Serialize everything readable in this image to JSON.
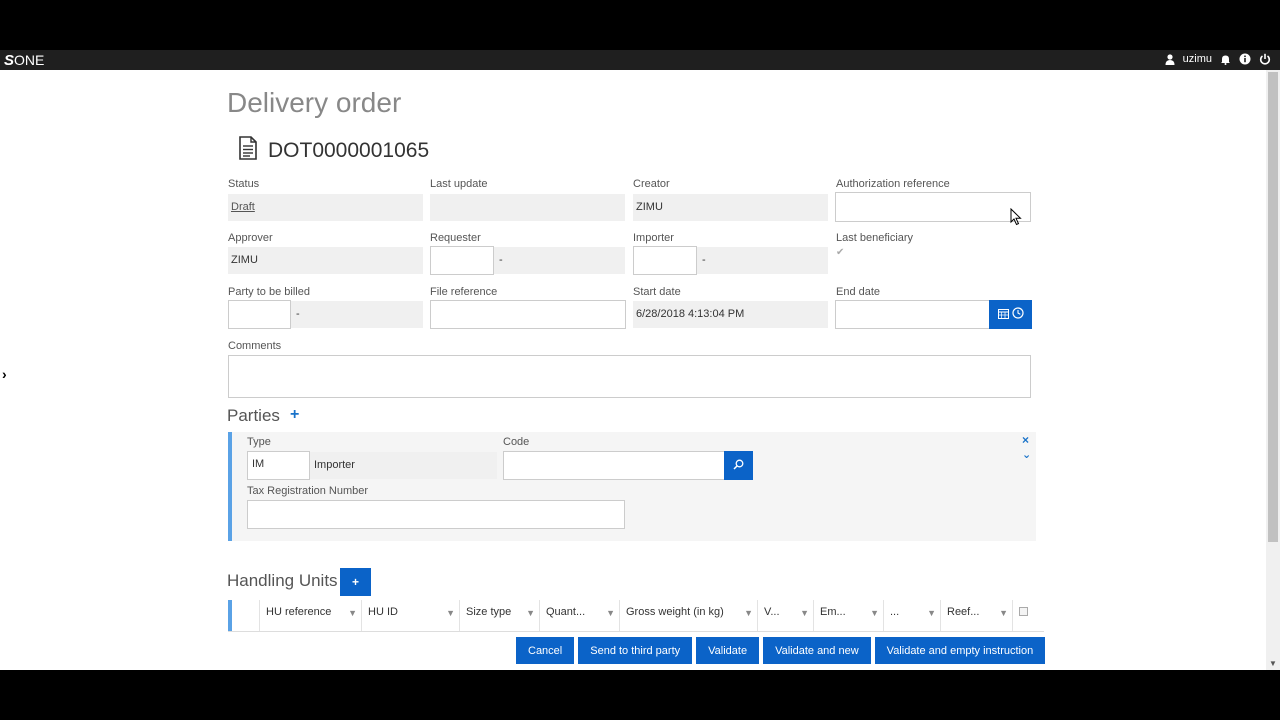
{
  "topbar": {
    "logo_s": "S",
    "logo_one": "ONE",
    "username": "uzimu"
  },
  "page": {
    "title": "Delivery order",
    "document_number": "DOT0000001065"
  },
  "fields": {
    "status": {
      "label": "Status",
      "value": "Draft"
    },
    "last_update": {
      "label": "Last update",
      "value": ""
    },
    "creator": {
      "label": "Creator",
      "value": "ZIMU"
    },
    "authorization_reference": {
      "label": "Authorization reference",
      "value": ""
    },
    "approver": {
      "label": "Approver",
      "value": "ZIMU"
    },
    "requester": {
      "label": "Requester",
      "code": "",
      "name": "-"
    },
    "importer": {
      "label": "Importer",
      "code": "",
      "name": "-"
    },
    "last_beneficiary": {
      "label": "Last beneficiary",
      "checked": true,
      "check_glyph": "✔"
    },
    "party_to_be_billed": {
      "label": "Party to be billed",
      "code": "",
      "name": "-"
    },
    "file_reference": {
      "label": "File reference",
      "value": ""
    },
    "start_date": {
      "label": "Start date",
      "value": "6/28/2018 4:13:04 PM"
    },
    "end_date": {
      "label": "End date",
      "value": ""
    },
    "comments": {
      "label": "Comments",
      "value": ""
    }
  },
  "parties": {
    "title": "Parties",
    "add_label": "+",
    "items": [
      {
        "type_label": "Type",
        "type_code": "IM",
        "type_name": "Importer",
        "code_label": "Code",
        "code_value": "",
        "tax_label": "Tax Registration Number",
        "tax_value": "",
        "remove_glyph": "×",
        "collapse_glyph": "⌄"
      }
    ]
  },
  "handling_units": {
    "title": "Handling Units",
    "add_label": "+",
    "columns": [
      {
        "label": "HU reference"
      },
      {
        "label": "HU ID"
      },
      {
        "label": "Size type"
      },
      {
        "label": "Quant..."
      },
      {
        "label": "Gross weight (in kg)"
      },
      {
        "label": "V..."
      },
      {
        "label": "Em..."
      },
      {
        "label": "..."
      },
      {
        "label": "Reef..."
      }
    ]
  },
  "actions": {
    "cancel": "Cancel",
    "send_to_third_party": "Send to third party",
    "validate": "Validate",
    "validate_and_new": "Validate and new",
    "validate_and_empty": "Validate and empty instruction"
  },
  "colors": {
    "primary": "#0b63c8",
    "accent_bar": "#5aa2e6",
    "topbar": "#1f1f1f"
  }
}
